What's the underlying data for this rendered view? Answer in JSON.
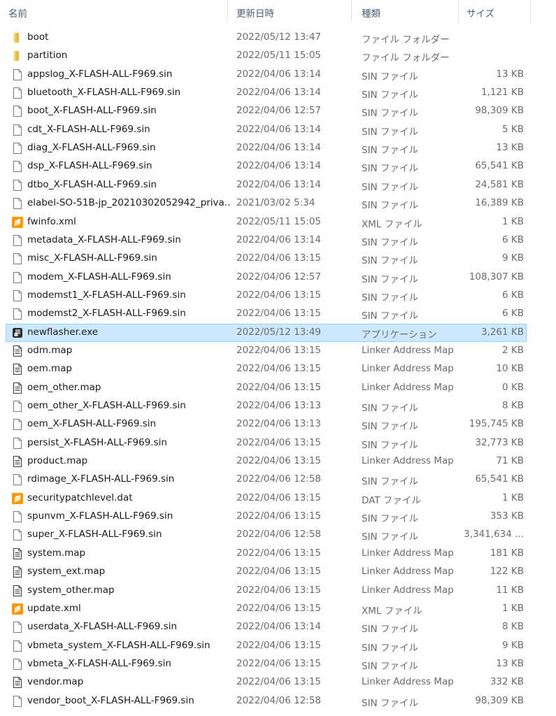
{
  "columns": {
    "name": "名前",
    "date": "更新日時",
    "type": "種類",
    "size": "サイズ"
  },
  "colors": {
    "folder": "#e8b844",
    "selected_bg": "#cce8ff",
    "sublime": "#ff9800"
  },
  "files": [
    {
      "name": "boot",
      "date": "2022/05/12 13:47",
      "type": "ファイル フォルダー",
      "size": "",
      "icon": "folder-icon"
    },
    {
      "name": "partition",
      "date": "2022/05/11 15:05",
      "type": "ファイル フォルダー",
      "size": "",
      "icon": "folder-icon"
    },
    {
      "name": "appslog_X-FLASH-ALL-F969.sin",
      "date": "2022/04/06 13:14",
      "type": "SIN ファイル",
      "size": "13 KB",
      "icon": "file-icon"
    },
    {
      "name": "bluetooth_X-FLASH-ALL-F969.sin",
      "date": "2022/04/06 13:14",
      "type": "SIN ファイル",
      "size": "1,121 KB",
      "icon": "file-icon"
    },
    {
      "name": "boot_X-FLASH-ALL-F969.sin",
      "date": "2022/04/06 12:57",
      "type": "SIN ファイル",
      "size": "98,309 KB",
      "icon": "file-icon"
    },
    {
      "name": "cdt_X-FLASH-ALL-F969.sin",
      "date": "2022/04/06 13:14",
      "type": "SIN ファイル",
      "size": "5 KB",
      "icon": "file-icon"
    },
    {
      "name": "diag_X-FLASH-ALL-F969.sin",
      "date": "2022/04/06 13:14",
      "type": "SIN ファイル",
      "size": "13 KB",
      "icon": "file-icon"
    },
    {
      "name": "dsp_X-FLASH-ALL-F969.sin",
      "date": "2022/04/06 13:14",
      "type": "SIN ファイル",
      "size": "65,541 KB",
      "icon": "file-icon"
    },
    {
      "name": "dtbo_X-FLASH-ALL-F969.sin",
      "date": "2022/04/06 13:14",
      "type": "SIN ファイル",
      "size": "24,581 KB",
      "icon": "file-icon"
    },
    {
      "name": "elabel-SO-51B-jp_20210302052942_priva...",
      "date": "2021/03/02 5:34",
      "type": "SIN ファイル",
      "size": "16,389 KB",
      "icon": "file-icon"
    },
    {
      "name": "fwinfo.xml",
      "date": "2022/05/11 15:05",
      "type": "XML ファイル",
      "size": "1 KB",
      "icon": "sublime-icon"
    },
    {
      "name": "metadata_X-FLASH-ALL-F969.sin",
      "date": "2022/04/06 13:14",
      "type": "SIN ファイル",
      "size": "6 KB",
      "icon": "file-icon"
    },
    {
      "name": "misc_X-FLASH-ALL-F969.sin",
      "date": "2022/04/06 13:15",
      "type": "SIN ファイル",
      "size": "9 KB",
      "icon": "file-icon"
    },
    {
      "name": "modem_X-FLASH-ALL-F969.sin",
      "date": "2022/04/06 12:57",
      "type": "SIN ファイル",
      "size": "108,307 KB",
      "icon": "file-icon"
    },
    {
      "name": "modemst1_X-FLASH-ALL-F969.sin",
      "date": "2022/04/06 13:15",
      "type": "SIN ファイル",
      "size": "6 KB",
      "icon": "file-icon"
    },
    {
      "name": "modemst2_X-FLASH-ALL-F969.sin",
      "date": "2022/04/06 13:15",
      "type": "SIN ファイル",
      "size": "6 KB",
      "icon": "file-icon"
    },
    {
      "name": "newflasher.exe",
      "date": "2022/05/12 13:49",
      "type": "アプリケーション",
      "size": "3,261 KB",
      "icon": "app-icon",
      "selected": true
    },
    {
      "name": "odm.map",
      "date": "2022/04/06 13:15",
      "type": "Linker Address Map",
      "size": "2 KB",
      "icon": "text-file-icon"
    },
    {
      "name": "oem.map",
      "date": "2022/04/06 13:15",
      "type": "Linker Address Map",
      "size": "10 KB",
      "icon": "text-file-icon"
    },
    {
      "name": "oem_other.map",
      "date": "2022/04/06 13:15",
      "type": "Linker Address Map",
      "size": "0 KB",
      "icon": "text-file-icon"
    },
    {
      "name": "oem_other_X-FLASH-ALL-F969.sin",
      "date": "2022/04/06 13:13",
      "type": "SIN ファイル",
      "size": "8 KB",
      "icon": "file-icon"
    },
    {
      "name": "oem_X-FLASH-ALL-F969.sin",
      "date": "2022/04/06 13:13",
      "type": "SIN ファイル",
      "size": "195,745 KB",
      "icon": "file-icon"
    },
    {
      "name": "persist_X-FLASH-ALL-F969.sin",
      "date": "2022/04/06 13:15",
      "type": "SIN ファイル",
      "size": "32,773 KB",
      "icon": "file-icon"
    },
    {
      "name": "product.map",
      "date": "2022/04/06 13:15",
      "type": "Linker Address Map",
      "size": "71 KB",
      "icon": "text-file-icon"
    },
    {
      "name": "rdimage_X-FLASH-ALL-F969.sin",
      "date": "2022/04/06 12:58",
      "type": "SIN ファイル",
      "size": "65,541 KB",
      "icon": "file-icon"
    },
    {
      "name": "securitypatchlevel.dat",
      "date": "2022/04/06 13:15",
      "type": "DAT ファイル",
      "size": "1 KB",
      "icon": "sublime-icon"
    },
    {
      "name": "spunvm_X-FLASH-ALL-F969.sin",
      "date": "2022/04/06 13:15",
      "type": "SIN ファイル",
      "size": "353 KB",
      "icon": "file-icon"
    },
    {
      "name": "super_X-FLASH-ALL-F969.sin",
      "date": "2022/04/06 12:58",
      "type": "SIN ファイル",
      "size": "3,341,634 ...",
      "icon": "file-icon"
    },
    {
      "name": "system.map",
      "date": "2022/04/06 13:15",
      "type": "Linker Address Map",
      "size": "181 KB",
      "icon": "text-file-icon"
    },
    {
      "name": "system_ext.map",
      "date": "2022/04/06 13:15",
      "type": "Linker Address Map",
      "size": "122 KB",
      "icon": "text-file-icon"
    },
    {
      "name": "system_other.map",
      "date": "2022/04/06 13:15",
      "type": "Linker Address Map",
      "size": "11 KB",
      "icon": "text-file-icon"
    },
    {
      "name": "update.xml",
      "date": "2022/04/06 13:15",
      "type": "XML ファイル",
      "size": "1 KB",
      "icon": "sublime-icon"
    },
    {
      "name": "userdata_X-FLASH-ALL-F969.sin",
      "date": "2022/04/06 13:14",
      "type": "SIN ファイル",
      "size": "8 KB",
      "icon": "file-icon"
    },
    {
      "name": "vbmeta_system_X-FLASH-ALL-F969.sin",
      "date": "2022/04/06 13:15",
      "type": "SIN ファイル",
      "size": "9 KB",
      "icon": "file-icon"
    },
    {
      "name": "vbmeta_X-FLASH-ALL-F969.sin",
      "date": "2022/04/06 13:15",
      "type": "SIN ファイル",
      "size": "13 KB",
      "icon": "file-icon"
    },
    {
      "name": "vendor.map",
      "date": "2022/04/06 13:15",
      "type": "Linker Address Map",
      "size": "332 KB",
      "icon": "text-file-icon"
    },
    {
      "name": "vendor_boot_X-FLASH-ALL-F969.sin",
      "date": "2022/04/06 12:58",
      "type": "SIN ファイル",
      "size": "98,309 KB",
      "icon": "file-icon"
    }
  ]
}
